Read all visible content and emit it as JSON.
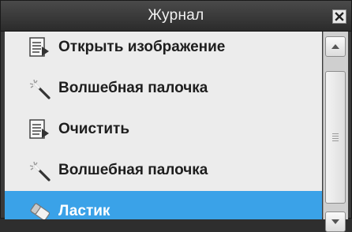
{
  "window": {
    "title": "Журнал"
  },
  "history": {
    "items": [
      {
        "label": "Открыть изображение",
        "icon": "document-icon",
        "selected": false
      },
      {
        "label": "Волшебная палочка",
        "icon": "magic-wand-icon",
        "selected": false
      },
      {
        "label": "Очистить",
        "icon": "document-icon",
        "selected": false
      },
      {
        "label": "Волшебная палочка",
        "icon": "magic-wand-icon",
        "selected": false
      },
      {
        "label": "Ластик",
        "icon": "eraser-icon",
        "selected": true
      }
    ]
  },
  "colors": {
    "selection": "#3aa2e8",
    "list_background": "#ececec",
    "titlebar": "#3a3a3a"
  }
}
